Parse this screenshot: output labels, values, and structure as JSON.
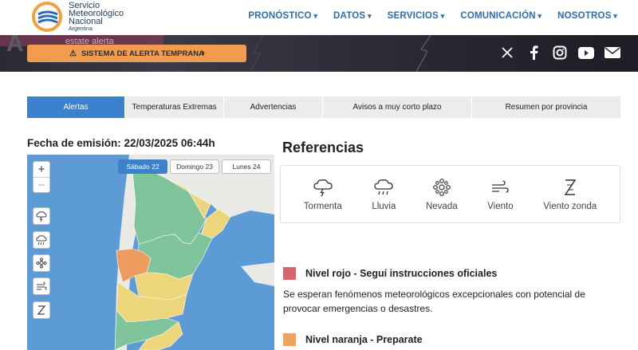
{
  "header": {
    "logo_lines": [
      "Servicio",
      "Meteorológico",
      "Nacional"
    ],
    "logo_country": "Argentina",
    "nav": [
      "PRONÓSTICO",
      "DATOS",
      "SERVICIOS",
      "COMUNICACIÓN",
      "NOSOTROS"
    ]
  },
  "banner": {
    "bg_text": "estate alerta",
    "alert_button": "SISTEMA DE ALERTA TEMPRANA",
    "social_icons": [
      "x-icon",
      "facebook-icon",
      "instagram-icon",
      "youtube-icon",
      "email-icon"
    ]
  },
  "tabs": [
    "Alertas",
    "Temperaturas Extremas",
    "Advertencias",
    "Avisos a muy corto plazo",
    "Resumen por provincia"
  ],
  "emission": "Fecha de emisión: 22/03/2025 06:44h",
  "map": {
    "zoom_in": "+",
    "zoom_out": "−",
    "days": [
      "Sábado 22",
      "Domingo 23",
      "Lunes 24"
    ],
    "controls": [
      "tormenta-icon",
      "lluvia-icon",
      "nevada-icon",
      "viento-icon",
      "viento-zonda-icon"
    ]
  },
  "references": {
    "title": "Referencias",
    "items": [
      "Tormenta",
      "Lluvia",
      "Nevada",
      "Viento",
      "Viento zonda"
    ]
  },
  "levels": {
    "red": {
      "title": "Nivel rojo - Seguí instrucciones oficiales",
      "desc": "Se esperan fenómenos meteorológicos excepcionales con potencial de provocar emergencias o desastres.",
      "color": "#d9646c"
    },
    "orange": {
      "title": "Nivel naranja - Preparate",
      "color": "#f2a25a"
    }
  },
  "colors": {
    "accent": "#3c81cc",
    "nav": "#2a6db5",
    "alert_button": "#f29b4e",
    "map_sea": "#5c9bd5",
    "map_green": "#7fc49a",
    "map_yellow": "#ecd57a",
    "map_orange": "#ef9a5e"
  }
}
